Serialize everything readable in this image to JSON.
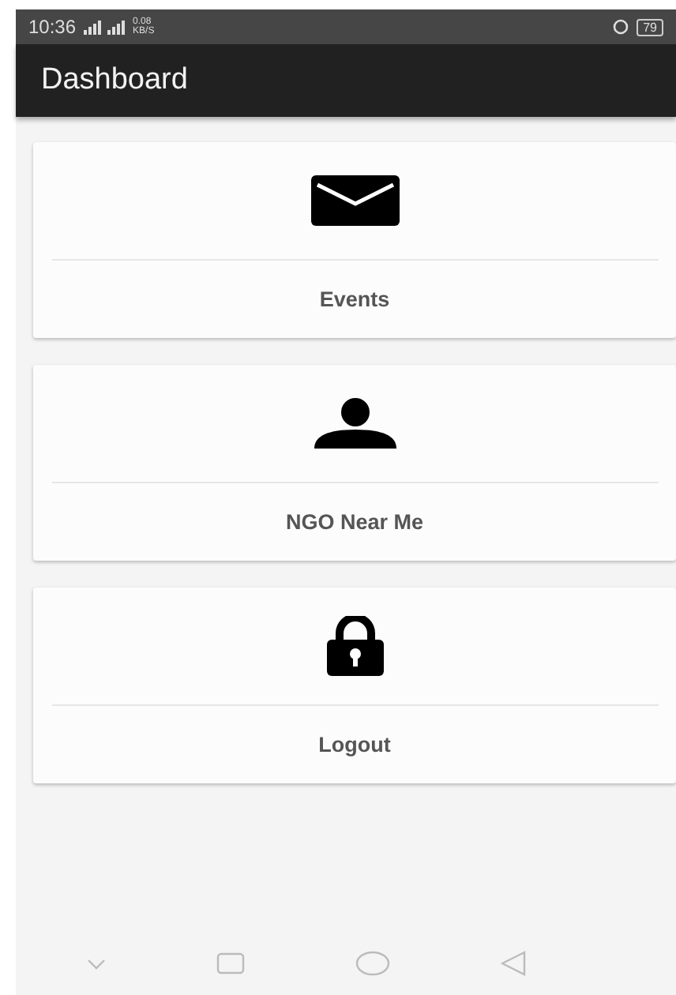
{
  "status_bar": {
    "time": "10:36",
    "speed": "0.08 KB/S",
    "battery": "79"
  },
  "app_bar": {
    "title": "Dashboard"
  },
  "cards": [
    {
      "kind": "envelope",
      "label": "Events"
    },
    {
      "kind": "person",
      "label": "NGO Near Me"
    },
    {
      "kind": "lock",
      "label": "Logout"
    }
  ]
}
